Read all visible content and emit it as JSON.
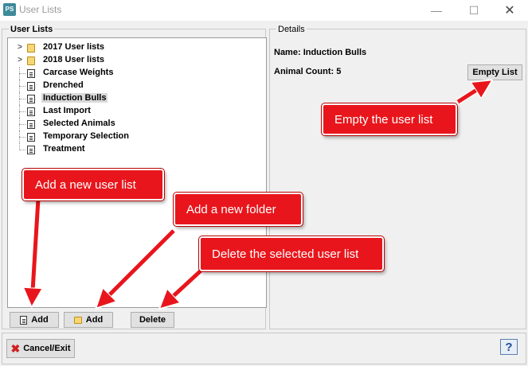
{
  "window": {
    "app_icon": "PS",
    "title": "User Lists",
    "minimize": "—",
    "maximize": "☐",
    "close": "✕"
  },
  "left_panel": {
    "legend": "User Lists",
    "tree": [
      {
        "label": "2017 User lists",
        "type": "folder",
        "expandable": true,
        "expander": ">"
      },
      {
        "label": "2018 User lists",
        "type": "folder",
        "expandable": true,
        "expander": ">"
      },
      {
        "label": "Carcase Weights",
        "type": "list"
      },
      {
        "label": "Drenched",
        "type": "list"
      },
      {
        "label": "Induction Bulls",
        "type": "list",
        "selected": true
      },
      {
        "label": "Last Import",
        "type": "list"
      },
      {
        "label": "Selected Animals",
        "type": "list"
      },
      {
        "label": "Temporary Selection",
        "type": "list"
      },
      {
        "label": "Treatment",
        "type": "list"
      }
    ],
    "buttons": {
      "add_list": "Add",
      "add_folder": "Add",
      "delete": "Delete"
    }
  },
  "details": {
    "legend": "Details",
    "name_label": "Name:",
    "name_value": "Induction Bulls",
    "count_label": "Animal Count:",
    "count_value": "5",
    "empty_button": "Empty List"
  },
  "bottom": {
    "cancel_label": "Cancel/Exit",
    "cancel_icon": "✖",
    "help_label": "?"
  },
  "callouts": {
    "empty": "Empty the user list",
    "add_list": "Add a new user list",
    "add_folder": "Add a new folder",
    "delete": "Delete the selected user list"
  },
  "colors": {
    "callout": "#e8161c",
    "folder": "#f7d774",
    "help": "#1a4f9a"
  }
}
